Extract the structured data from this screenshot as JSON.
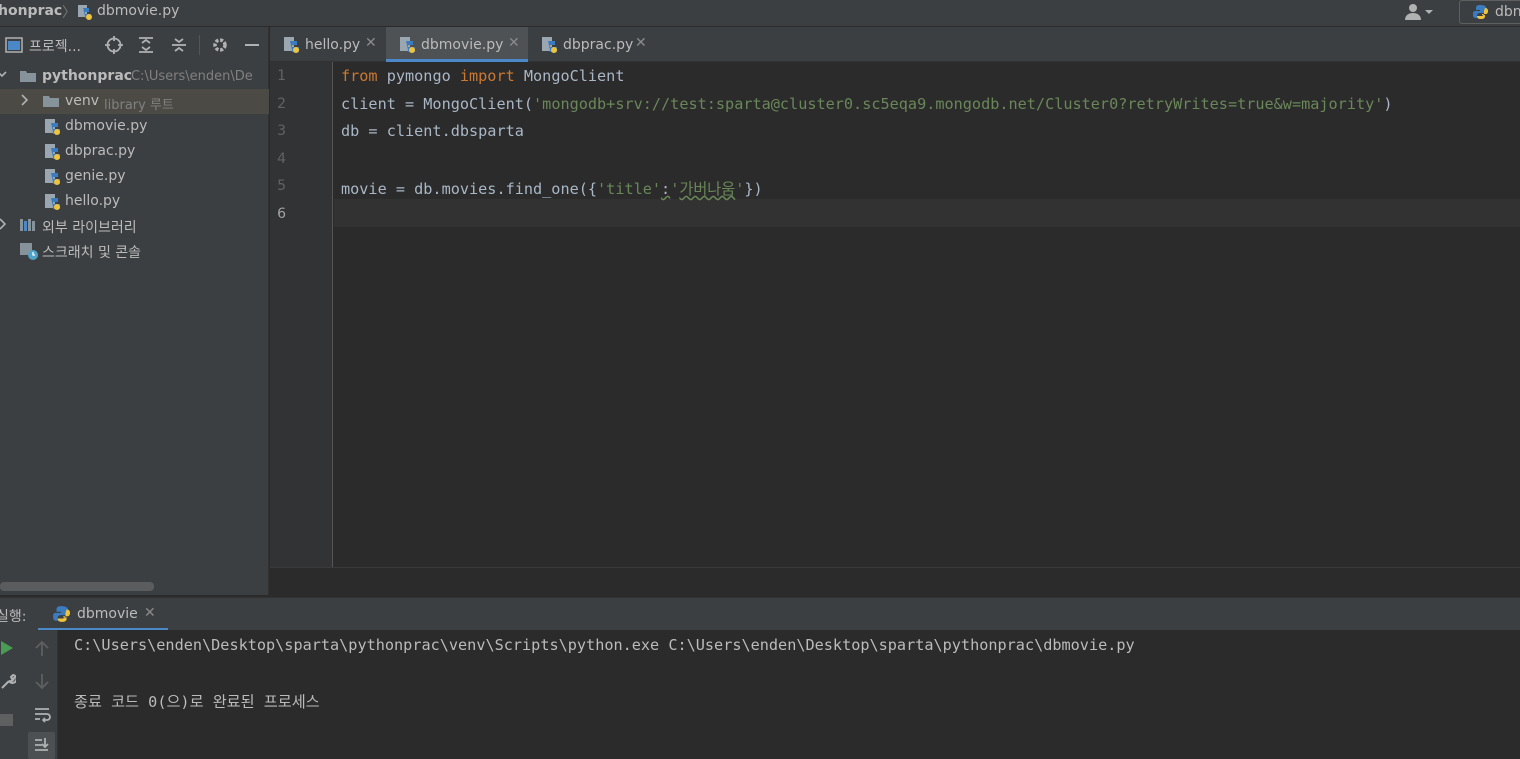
{
  "breadcrumb": {
    "project": "honprac",
    "file": "dbmovie.py"
  },
  "run_config": {
    "label": "dbn"
  },
  "project_panel": {
    "title": "프로젝...",
    "tree": [
      {
        "label": "pythonprac",
        "hint": "C:\\Users\\enden\\De",
        "kind": "folder-root"
      },
      {
        "label": "venv",
        "hint": "library 루트",
        "kind": "folder"
      },
      {
        "label": "dbmovie.py",
        "kind": "python-file"
      },
      {
        "label": "dbprac.py",
        "kind": "python-file"
      },
      {
        "label": "genie.py",
        "kind": "python-file"
      },
      {
        "label": "hello.py",
        "kind": "python-file"
      },
      {
        "label": "외부 라이브러리",
        "kind": "libraries"
      },
      {
        "label": "스크래치 및 콘솔",
        "kind": "scratches"
      }
    ]
  },
  "editor_tabs": [
    {
      "label": "hello.py",
      "active": false
    },
    {
      "label": "dbmovie.py",
      "active": true
    },
    {
      "label": "dbprac.py",
      "active": false
    }
  ],
  "editor": {
    "line_numbers": [
      "1",
      "2",
      "3",
      "4",
      "5",
      "6"
    ],
    "current_line": 6,
    "code": {
      "l1_kw1": "from",
      "l1_mod": " pymongo ",
      "l1_kw2": "import",
      "l1_rest": " MongoClient",
      "l2_a": "client = MongoClient(",
      "l2_str": "'mongodb+srv://test:sparta@cluster0.sc5eqa9.mongodb.net/Cluster0?retryWrites=true&w=majority'",
      "l2_b": ")",
      "l3": "db = client.dbsparta",
      "l5_a": "movie = db.movies.find_one({",
      "l5_key": "'title'",
      "l5_colon": ":",
      "l5_q1": "'",
      "l5_val": "가버나움",
      "l5_q2": "'",
      "l5_b": "})"
    }
  },
  "run_panel": {
    "label": "실행:",
    "tab_label": "dbmovie",
    "console_lines": [
      "C:\\Users\\enden\\Desktop\\sparta\\pythonprac\\venv\\Scripts\\python.exe C:\\Users\\enden\\Desktop\\sparta\\pythonprac\\dbmovie.py",
      "",
      "종료 코드 0(으)로 완료된 프로세스"
    ]
  },
  "colors": {
    "keyword": "#cc7832",
    "string": "#6a8759",
    "accent": "#4a88c7",
    "run_green": "#499c54"
  }
}
